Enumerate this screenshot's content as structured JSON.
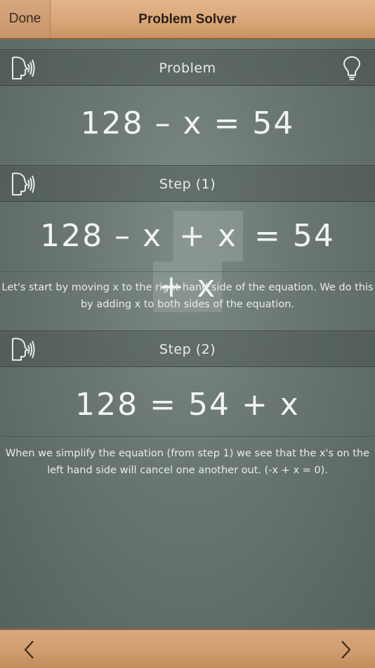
{
  "header": {
    "done_label": "Done",
    "title": "Problem Solver"
  },
  "problem": {
    "label": "Problem",
    "equation": [
      "128 – x = 54"
    ]
  },
  "step1": {
    "label": "Step (1)",
    "eq_left": "128 – x",
    "eq_added_left": "+ x",
    "eq_middle": "= 54",
    "eq_added_right": "+ x",
    "explanation": "Let's start by moving x to the right hand side of the equation. We do this by adding x to both sides of the equation."
  },
  "step2": {
    "label": "Step (2)",
    "equation": "128 = 54 + x",
    "explanation": "When we simplify the equation (from step 1) we see that the x's on the left hand side will cancel one another out. (-x + x = 0)."
  },
  "icons": {
    "speak": "speak-icon",
    "hint": "lightbulb-icon",
    "back": "chevron-left-icon",
    "forward": "chevron-right-icon"
  },
  "colors": {
    "wood": "#d9a577",
    "chalkboard": "#6b7872",
    "chalk": "#f3f4f2"
  }
}
